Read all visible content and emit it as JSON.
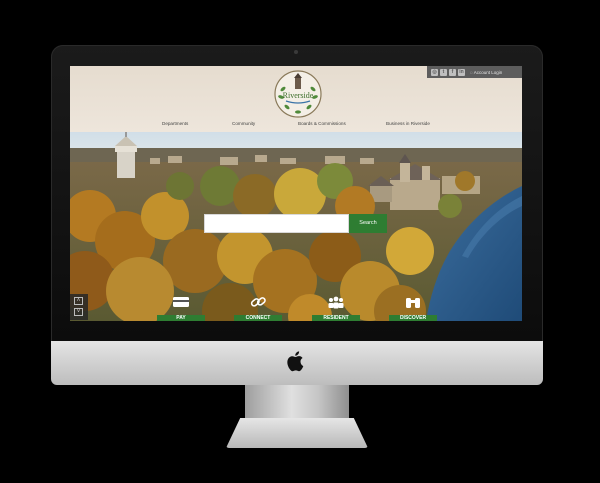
{
  "site": {
    "logo_text": "Riverside",
    "account_login": "Account Login",
    "social_icons": [
      "instagram-icon",
      "twitter-icon",
      "facebook-icon",
      "linkedin-icon"
    ],
    "nav": {
      "departments": "Departments",
      "community": "Community",
      "boards": "Boards & Commissions",
      "business": "Business in Riverside"
    },
    "search": {
      "placeholder": "",
      "button": "Search"
    },
    "quick_links": {
      "pay": "PAY",
      "connect": "CONNECT",
      "resident": "RESIDENT",
      "discover": "DISCOVER"
    }
  },
  "colors": {
    "header_bg": "#efe6db",
    "utility_bar": "#5d5d5d",
    "accent_green": "#2e7d32",
    "river": "#2f5e8c"
  }
}
